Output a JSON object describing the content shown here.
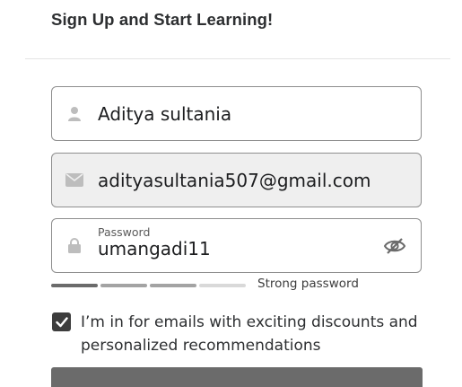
{
  "header": {
    "title": "Sign Up and Start Learning!"
  },
  "form": {
    "name_field": {
      "value": "Aditya sultania",
      "icon": "user-icon"
    },
    "email_field": {
      "value": "adityasultania507@gmail.com",
      "icon": "envelope-icon"
    },
    "password_field": {
      "label": "Password",
      "value": "umangadi11",
      "icon": "lock-icon",
      "toggle_icon": "eye-slash-icon"
    },
    "password_strength": {
      "label": "Strong password",
      "level": 3,
      "max_level": 4
    },
    "consent": {
      "checked": true,
      "text": "I’m in for emails with exciting discounts and personalized recommendations"
    }
  },
  "colors": {
    "field_border": "#8e8e8e",
    "checkbox": "#3d3d3d",
    "submit_button": "#6b6b6b"
  }
}
